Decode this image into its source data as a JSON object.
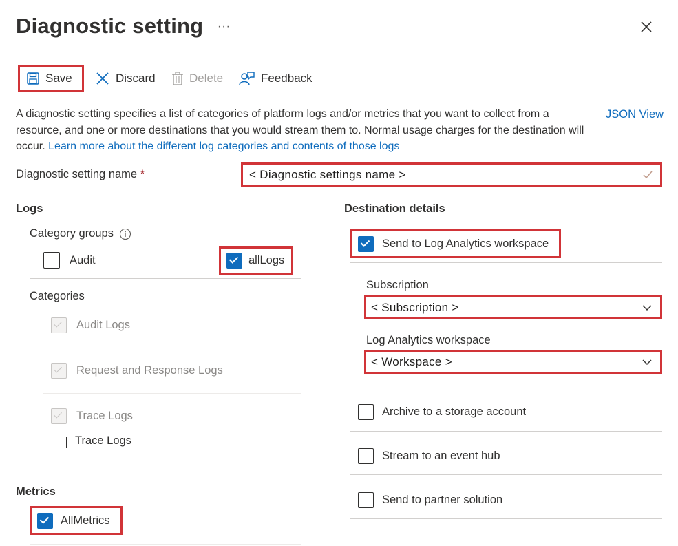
{
  "header": {
    "title": "Diagnostic setting",
    "more": "···"
  },
  "toolbar": {
    "save": "Save",
    "discard": "Discard",
    "delete": "Delete",
    "feedback": "Feedback"
  },
  "description": {
    "text": "A diagnostic setting specifies a list of categories of platform logs and/or metrics that you want to collect from a resource, and one or more destinations that you would stream them to. Normal usage charges for the destination will occur. ",
    "link": "Learn more about the different log categories and contents of those logs",
    "json_view": "JSON View"
  },
  "name_field": {
    "label": "Diagnostic setting name",
    "required_mark": "*",
    "value": "< Diagnostic settings name >"
  },
  "logs": {
    "heading": "Logs",
    "category_groups_label": "Category groups",
    "groups": [
      {
        "label": "Audit",
        "checked": false
      },
      {
        "label": "allLogs",
        "checked": true
      }
    ],
    "categories_label": "Categories",
    "categories": [
      {
        "label": "Audit Logs",
        "checked": true,
        "disabled": true
      },
      {
        "label": "Request and Response Logs",
        "checked": true,
        "disabled": true
      },
      {
        "label": "Trace Logs",
        "checked": true,
        "disabled": true
      }
    ],
    "overlap_label": "Trace Logs"
  },
  "metrics": {
    "heading": "Metrics",
    "items": [
      {
        "label": "AllMetrics",
        "checked": true
      }
    ]
  },
  "destination": {
    "heading": "Destination details",
    "log_analytics": {
      "label": "Send to Log Analytics workspace",
      "checked": true
    },
    "subscription_label": "Subscription",
    "subscription_value": "< Subscription >",
    "workspace_label": "Log Analytics workspace",
    "workspace_value": "< Workspace >",
    "others": [
      {
        "label": "Archive to a storage account",
        "checked": false
      },
      {
        "label": "Stream to an event hub",
        "checked": false
      },
      {
        "label": "Send to partner solution",
        "checked": false
      }
    ]
  },
  "colors": {
    "highlight": "#d13438",
    "accent": "#0f6cbd",
    "text": "#323130"
  }
}
